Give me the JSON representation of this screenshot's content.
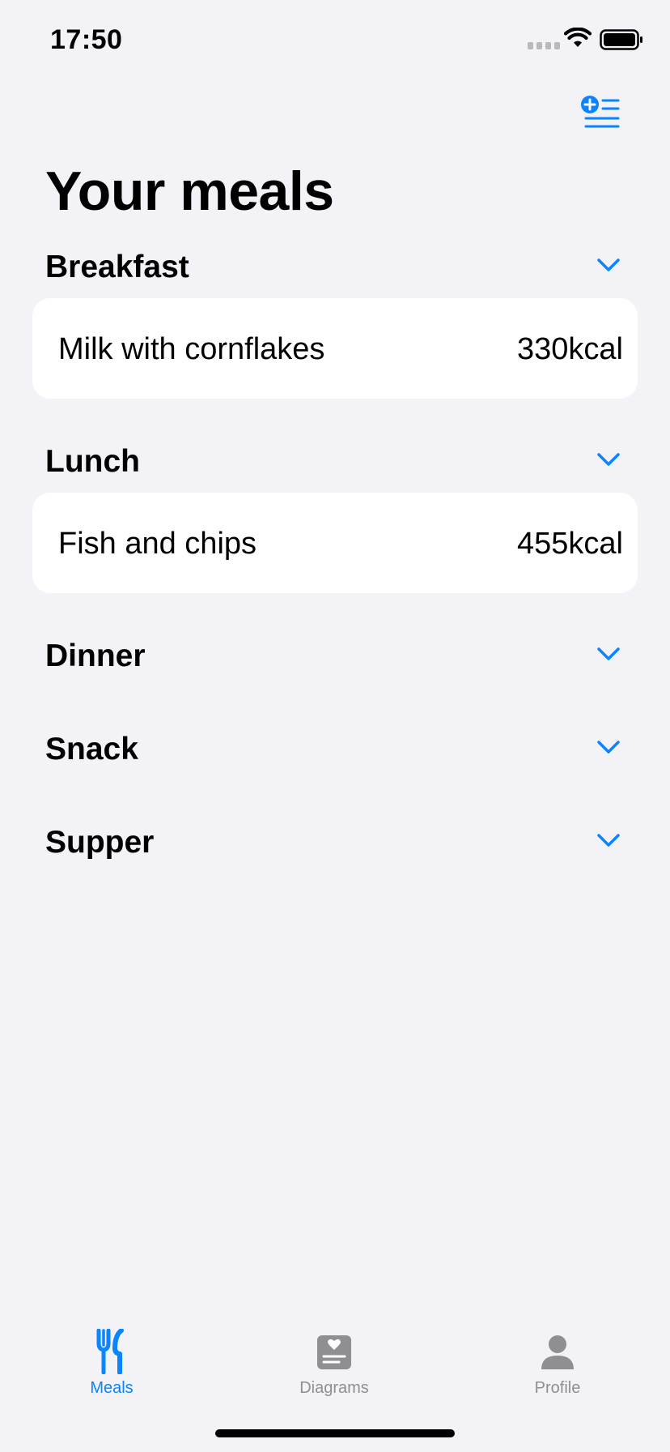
{
  "status_bar": {
    "time": "17:50",
    "wifi_icon": "wifi-icon",
    "battery_icon": "battery-icon"
  },
  "header": {
    "add_button_icon": "add-list-icon",
    "title": "Your meals"
  },
  "sections": [
    {
      "title": "Breakfast",
      "icon": "chevron-down-icon",
      "items": [
        {
          "name": "Milk with cornflakes",
          "kcal": "330kcal"
        }
      ]
    },
    {
      "title": "Lunch",
      "icon": "chevron-down-icon",
      "items": [
        {
          "name": "Fish and chips",
          "kcal": "455kcal"
        }
      ]
    },
    {
      "title": "Dinner",
      "icon": "chevron-down-icon",
      "items": []
    },
    {
      "title": "Snack",
      "icon": "chevron-down-icon",
      "items": []
    },
    {
      "title": "Supper",
      "icon": "chevron-down-icon",
      "items": []
    }
  ],
  "tab_bar": {
    "tabs": [
      {
        "label": "Meals",
        "icon": "fork-knife-icon",
        "active": true
      },
      {
        "label": "Diagrams",
        "icon": "heart-chart-icon",
        "active": false
      },
      {
        "label": "Profile",
        "icon": "person-icon",
        "active": false
      }
    ]
  },
  "colors": {
    "accent": "#0a84ff",
    "background": "#f2f2f7",
    "card": "#ffffff",
    "inactive": "#8e8e93"
  }
}
